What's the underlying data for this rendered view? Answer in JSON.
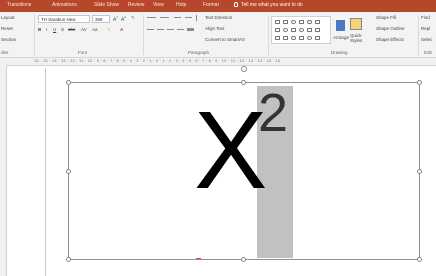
{
  "menu_tabs": [
    "Transitions",
    "Animations",
    "Slide Show",
    "Review",
    "View",
    "Help",
    "Format"
  ],
  "tell_me": "Tell me what you want to do",
  "ribbon": {
    "slides": {
      "layout": "Layout",
      "reset": "Reset",
      "section": "Section",
      "group_label": "des"
    },
    "font": {
      "name": "TH Sarabun New",
      "size": "388",
      "group_label": "Font",
      "change_case": "Aa"
    },
    "paragraph": {
      "text_direction": "Text Direction",
      "align_text": "Align Text",
      "convert_smartart": "Convert to SmartArt",
      "group_label": "Paragraph"
    },
    "drawing": {
      "arrange": "Arrange",
      "quick_styles": "Quick Styles",
      "shape_fill": "Shape Fill",
      "shape_outline": "Shape Outline",
      "shape_effects": "Shape Effects",
      "group_label": "Drawing"
    },
    "editing": {
      "find": "Find",
      "replace": "Repl",
      "select": "Selec",
      "group_label": "Edit"
    }
  },
  "ruler_text": "16 · 15 · 14 · 13 · 12 · 11 · 10 · 9 · 8 · 7 · 6 · 5 · 4 · 3 · 2 · 1 · 0 · 1 · 2 · 3 · 4 · 5 · 6 · 7 · 8 · 9 · 10 · 11 · 12 · 13 · 14 · 15 · 16",
  "slide": {
    "base_text": "X",
    "superscript_text": "2"
  },
  "colors": {
    "accent": "#b7472a",
    "highlight": "#c1c1c1"
  }
}
